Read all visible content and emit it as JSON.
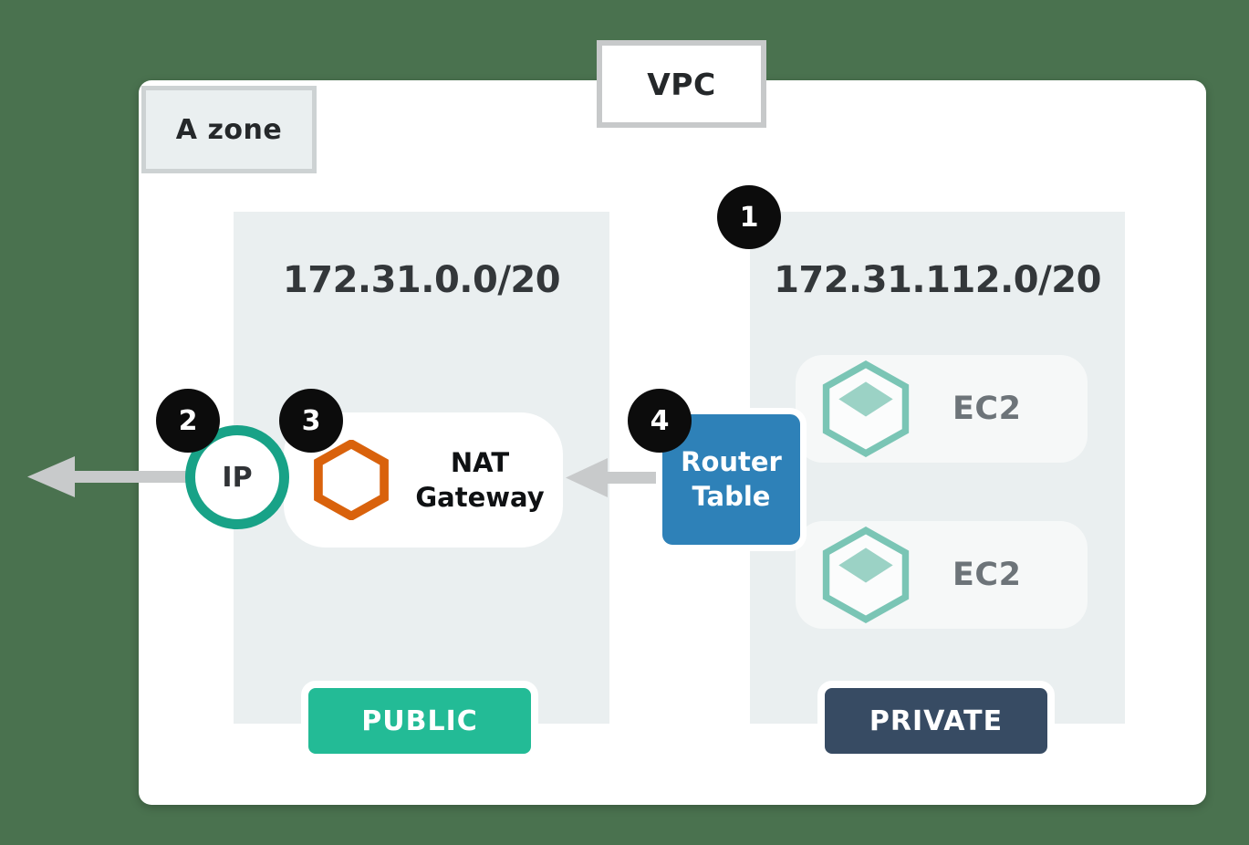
{
  "diagram": {
    "background_color": "#4a724f",
    "container_label": "VPC",
    "zone_label": "A zone"
  },
  "subnets": [
    {
      "id": "public",
      "cidr": "172.31.0.0/20",
      "tier_label": "PUBLIC",
      "tier_color": "#23bb96"
    },
    {
      "id": "private",
      "cidr": "172.31.112.0/20",
      "tier_label": "PRIVATE",
      "tier_color": "#374b63"
    }
  ],
  "badges": [
    {
      "number": "1"
    },
    {
      "number": "2"
    },
    {
      "number": "3"
    },
    {
      "number": "4"
    }
  ],
  "nodes": {
    "ip": {
      "label": "IP",
      "icon": "ip-circle-icon",
      "color": "#18a287"
    },
    "nat_gateway": {
      "line1": "NAT",
      "line2": "Gateway",
      "icon": "nat-gateway-hexagon-icon",
      "color": "#d9620c"
    },
    "router_table": {
      "line1": "Router",
      "line2": "Table",
      "color": "#2e81b8"
    },
    "ec2_instances": [
      {
        "label": "EC2",
        "icon": "ec2-hexagon-icon",
        "color": "#7ac5b5"
      },
      {
        "label": "EC2",
        "icon": "ec2-hexagon-icon",
        "color": "#7ac5b5"
      }
    ]
  },
  "arrows": [
    {
      "name": "internet-egress-arrow",
      "direction": "left",
      "color": "#c8cacb"
    },
    {
      "name": "router-to-nat-arrow",
      "direction": "left",
      "color": "#c8cacb"
    }
  ]
}
